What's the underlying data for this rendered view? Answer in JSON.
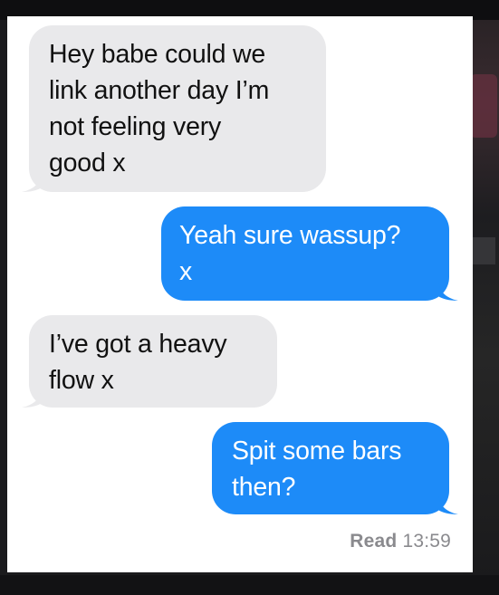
{
  "conversation": {
    "messages": [
      {
        "direction": "incoming",
        "text": "Hey babe could we\nlink another day I’m\nnot feeling very\ngood x"
      },
      {
        "direction": "outgoing",
        "text": "Yeah sure wassup?\nx"
      },
      {
        "direction": "incoming",
        "text": "I’ve got a heavy\nflow x"
      },
      {
        "direction": "outgoing",
        "text": "Spit some bars\nthen?"
      }
    ],
    "read_receipt": {
      "label": "Read",
      "time": "13:59"
    }
  },
  "colors": {
    "incoming_bubble": "#e9e9eb",
    "outgoing_bubble": "#1d8bf8",
    "receipt_text": "#8a8a8e"
  }
}
